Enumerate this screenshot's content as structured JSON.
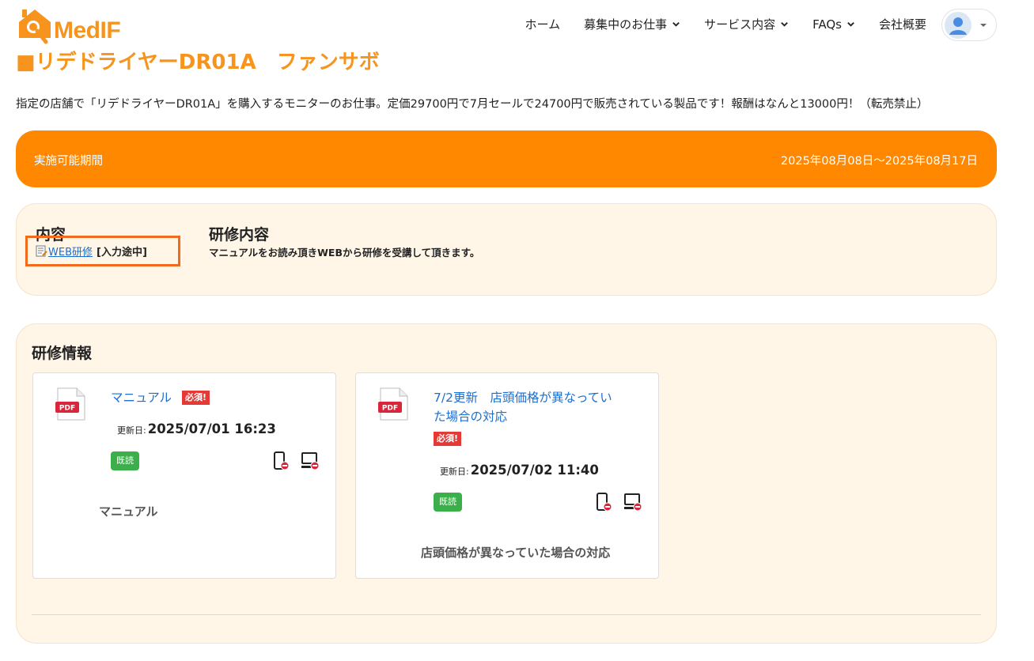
{
  "brand": {
    "name": "MedIF",
    "color": "#f7941d"
  },
  "nav": {
    "items": [
      {
        "label": "ホーム",
        "dropdown": false
      },
      {
        "label": "募集中のお仕事",
        "dropdown": true
      },
      {
        "label": "サービス内容",
        "dropdown": true
      },
      {
        "label": "FAQs",
        "dropdown": true
      },
      {
        "label": "会社概要",
        "dropdown": false
      }
    ],
    "user_menu_icon": "user-avatar-icon"
  },
  "page": {
    "title": "■リデドライヤーDR01A　ファンサボ",
    "description": "指定の店舗で「リデドライヤーDR01A」を購入するモニターのお仕事。定価29700円で7月セールで24700円で販売されている製品です！報酬はなんと13000円！（転売禁止）"
  },
  "period": {
    "label": "実施可能期間",
    "value": "2025年08月08日〜2025年08月17日",
    "color": "#ff8800"
  },
  "content": {
    "heading": "内容",
    "link_label": "WEB研修",
    "link_status": "[入力途中]",
    "training_heading": "研修内容",
    "training_desc": "マニュアルをお読み頂きWEBから研修を受講して頂きます。"
  },
  "training": {
    "heading": "研修情報",
    "documents": [
      {
        "title": "マニュアル",
        "required_badge": "必須!",
        "updated_label": "更新日:",
        "updated_at": "2025/07/01 16:23",
        "read_badge": "既読",
        "caption": "マニュアル",
        "file_type": "PDF"
      },
      {
        "title": "7/2更新　店頭価格が異なっていた場合の対応",
        "title_line1": "7/2更新　店頭価格が異なってい",
        "title_line2": "た場合の対応",
        "required_badge": "必須!",
        "updated_label": "更新日:",
        "updated_at": "2025/07/02 11:40",
        "read_badge": "既読",
        "caption": "店頭価格が異なっていた場合の対応",
        "file_type": "PDF"
      }
    ]
  }
}
